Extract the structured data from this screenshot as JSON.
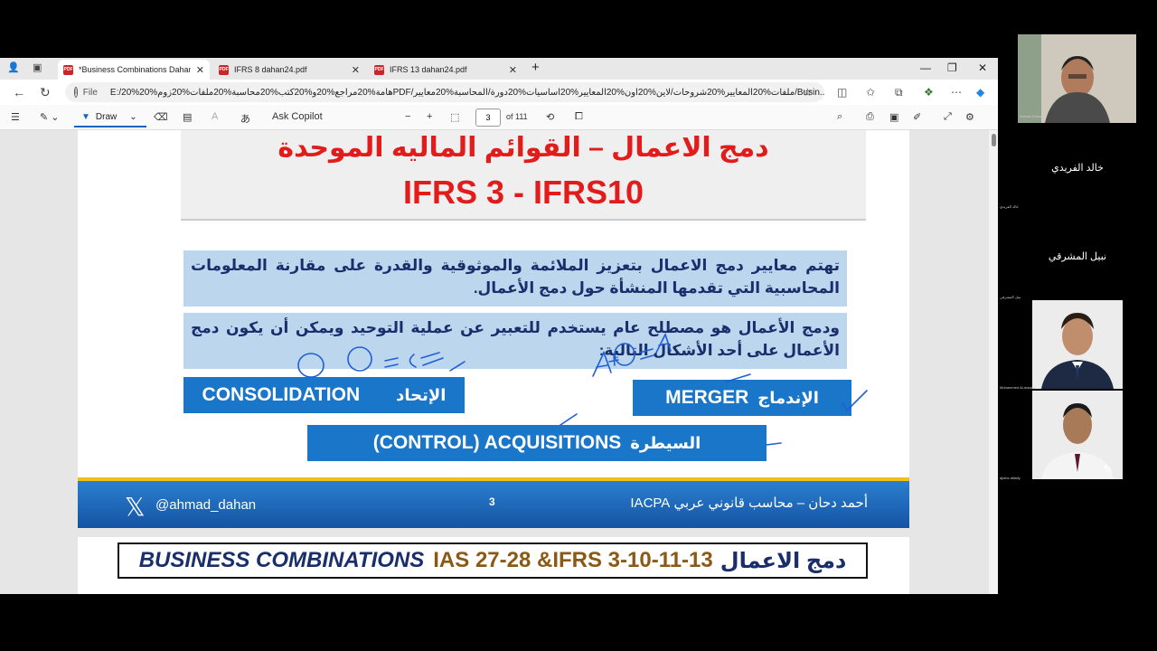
{
  "browser": {
    "tabs": [
      {
        "label": "*Business Combinations Dahan 2...",
        "active": true
      },
      {
        "label": "IFRS 8 dahan24.pdf",
        "active": false
      },
      {
        "label": "IFRS 13 dahan24.pdf",
        "active": false
      }
    ],
    "new_tab": "+",
    "address": {
      "file_label": "File",
      "url": "E:/20%هامة%20مراجع%20و%20كتب%20محاسبة%20ملفات%20زوم%20PDF/ملفات%20المعايير%20شروحات/لاين%20اون%20المعايير%20اساسيات%20دورة/المحاسبة%20معايير/Busin..."
    }
  },
  "pdf_toolbar": {
    "draw_label": "Draw",
    "ask_copilot": "Ask Copilot",
    "page_current": "3",
    "page_total": "of 111"
  },
  "slide": {
    "title_ar": "دمج الاعمال – القوائم الماليه الموحدة",
    "title_en": "IFRS 3 - IFRS10",
    "para1": "تهتم معايير دمج الاعمال بتعزيز الملائمة والموثوقية والقدرة على مقارنة المعلومات المحاسبية التي تقدمها المنشأة حول دمج الأعمال.",
    "para2": "ودمج الأعمال هو مصطلح عام يستخدم للتعبير عن عملية التوحيد ويمكن أن يكون دمج الأعمال على أحد الأشكال التالية:",
    "consolidation_en": "CONSOLIDATION",
    "consolidation_ar": "الإتحاد",
    "merger_en": "MERGER",
    "merger_ar": "الإندماج",
    "acquisitions_en": "(CONTROL) ACQUISITIONS",
    "acquisitions_ar": "السيطرة",
    "footer_handle": "@ahmad_dahan",
    "footer_page": "3",
    "footer_author": "أحمد دحان – محاسب قانوني عربي IACPA",
    "ink_left": "A + B = C",
    "ink_right": "A + B = A"
  },
  "next_slide": {
    "banner_en": "BUSINESS COMBINATIONS",
    "banner_mid": "IAS 27-28 &IFRS 3-10-11-13",
    "banner_ar": "دمج الاعمال"
  },
  "participants": {
    "presenter_small": "Ahmad Dahan",
    "p1": "خالد الفريدي",
    "p1_small": "خالد الفريدي",
    "p2": "نبيل المشرقي",
    "p2_small": "نبيل المشرقي",
    "p3_small": "Mohammed Al-madani",
    "p4_small": "ajoibs alitaily"
  }
}
